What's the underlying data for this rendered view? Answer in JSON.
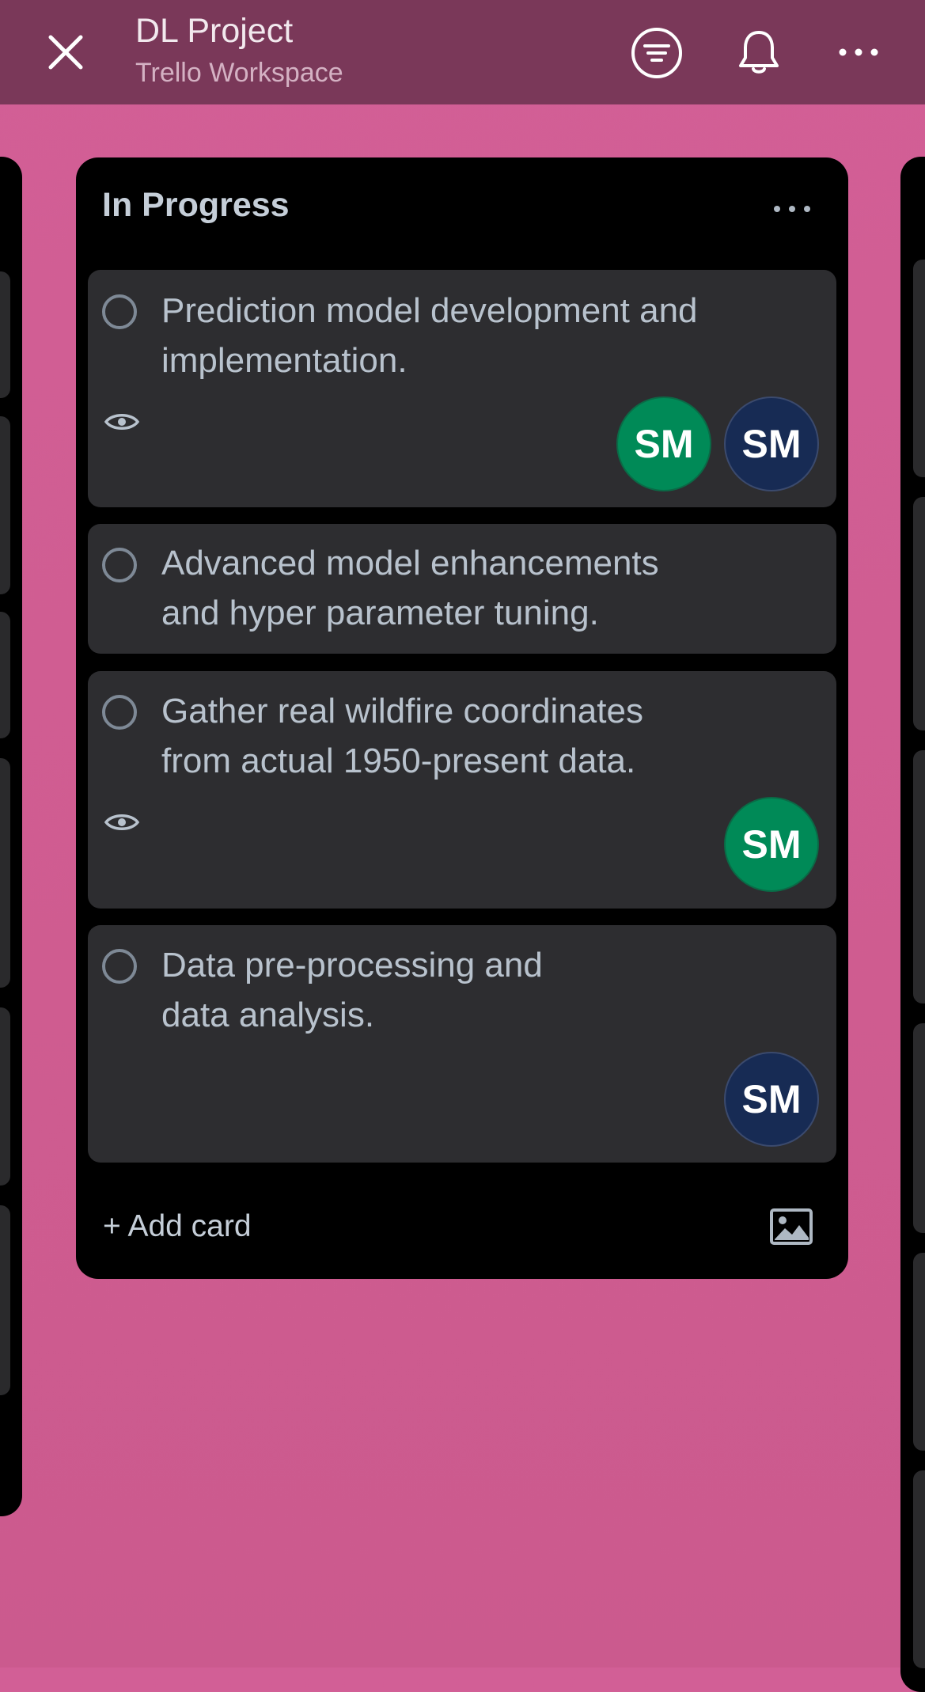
{
  "header": {
    "board_title": "DL Project",
    "workspace": "Trello Workspace",
    "icons": [
      "close-icon",
      "filter-icon",
      "bell-icon",
      "more-icon"
    ]
  },
  "list": {
    "title": "In Progress",
    "menu_icon": "more-icon",
    "add_card_label": "+ Add card",
    "add_card_icon": "image-icon"
  },
  "cards": [
    {
      "title": "Prediction model development and\nimplementation.",
      "watching": true,
      "members": [
        "SM",
        "SM"
      ]
    },
    {
      "title": "Advanced model enhancements\nand hyper parameter tuning.",
      "watching": false,
      "members": []
    },
    {
      "title": "Gather real wildfire coordinates\nfrom actual 1950-present data.",
      "watching": true,
      "members": [
        "SM"
      ]
    },
    {
      "title": "Data pre-processing and\ndata analysis.",
      "watching": false,
      "members": [
        "SM"
      ]
    }
  ],
  "colors": {
    "header_bg": "#7a3859",
    "board_bg": "#d25f96",
    "list_bg": "#000000",
    "card_bg": "#2d2d30",
    "avatar_green": "#008a57",
    "avatar_navy": "#172b54"
  }
}
